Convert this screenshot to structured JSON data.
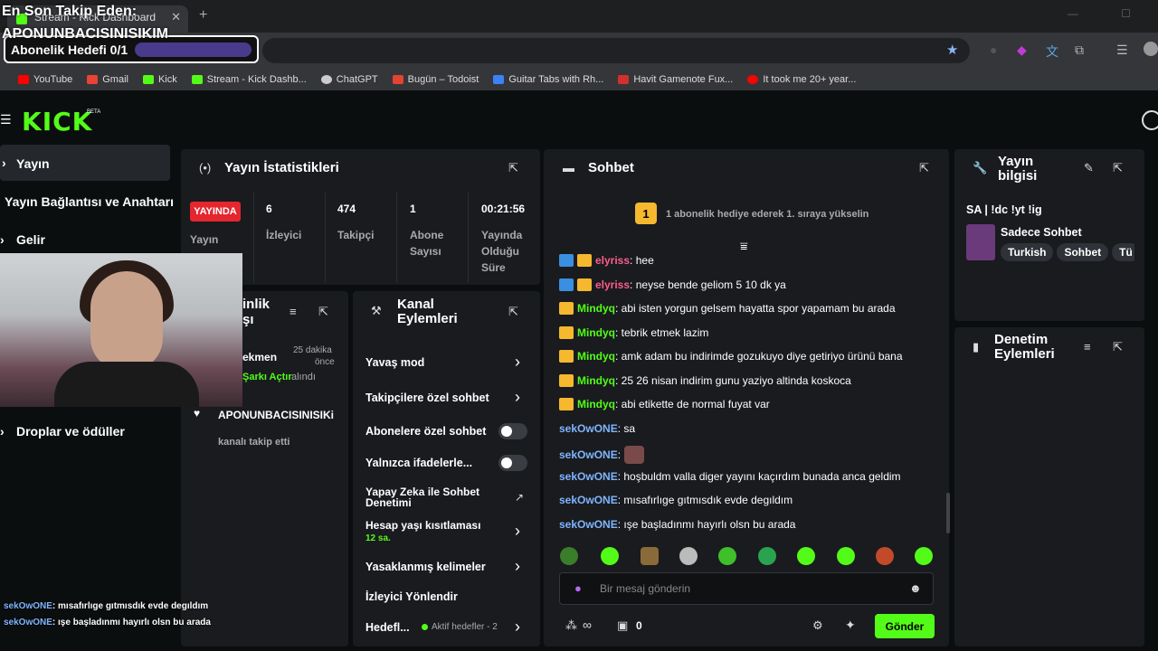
{
  "browser": {
    "tab_title": "Stream - Kick Dashboard",
    "new_tab": "+",
    "bookmarks": [
      {
        "label": "YouTube",
        "color": "#ff0000"
      },
      {
        "label": "Gmail",
        "color": "#ea4335"
      },
      {
        "label": "Kick",
        "color": "#53fc18"
      },
      {
        "label": "Stream - Kick Dashb...",
        "color": "#53fc18"
      },
      {
        "label": "ChatGPT",
        "color": "#cccccc"
      },
      {
        "label": "Bugün – Todoist",
        "color": "#e44332"
      },
      {
        "label": "Guitar Tabs with Rh...",
        "color": "#3b82f6"
      },
      {
        "label": "Havit Gamenote Fux...",
        "color": "#d32f2f"
      },
      {
        "label": "It took me 20+ year...",
        "color": "#ff0000"
      }
    ]
  },
  "overlay": {
    "last_follower_title": "En Son Takip Eden:",
    "last_follower_name": "APONUNBACISINISIKIM",
    "sub_goal": "Abonelik Hedefi 0/1",
    "chat": [
      {
        "user": "sekOwONE",
        "text": ": mısafırlıge gıtmısdık evde degıldım"
      },
      {
        "user": "sekOwONE",
        "text": ": ışe başladınmı hayırlı olsn bu arada"
      }
    ]
  },
  "kick": {
    "logo": "KICK",
    "beta": "BETA"
  },
  "sidebar": {
    "items": [
      {
        "label": "Yayın"
      },
      {
        "label": "Yayın Bağlantısı ve Anahtarı"
      },
      {
        "label": "Gelir"
      },
      {
        "label": "Droplar ve ödüller"
      }
    ]
  },
  "stats": {
    "title": "Yayın İstatistikleri",
    "live": "YAYINDA",
    "live_label": "Yayın",
    "viewers": "6",
    "viewers_label": "İzleyici",
    "followers": "474",
    "followers_label": "Takipçi",
    "subs": "1",
    "subs_label_1": "Abone",
    "subs_label_2": "Sayısı",
    "duration": "00:21:56",
    "duration_label_1": "Yayında",
    "duration_label_2": "Olduğu",
    "duration_label_3": "Süre"
  },
  "events": {
    "title_1": "inlik",
    "title_2": "şı",
    "item1_name": "ekmen",
    "item1_time_1": "25 dakika",
    "item1_time_2": "önce",
    "item1_action": "Şarkı Açtır",
    "item1_suffix": " alındı",
    "item2_name": "APONUNBACISINISIKi",
    "item2_desc": "kanalı takip etti"
  },
  "actions": {
    "title_1": "Kanal",
    "title_2": "Eylemleri",
    "items": [
      {
        "label": "Yavaş mod"
      },
      {
        "label": "Takipçilere özel sohbet"
      },
      {
        "label": "Abonelere özel sohbet"
      },
      {
        "label": "Yalnızca ifadelerle..."
      },
      {
        "label": "Yapay Zeka ile Sohbet"
      },
      {
        "label": "Denetimi"
      },
      {
        "label": "Hesap yaşı kısıtlaması"
      },
      {
        "label": "12 sa."
      },
      {
        "label": "Yasaklanmış kelimeler"
      },
      {
        "label": "İzleyici Yönlendir"
      },
      {
        "label": "Hedefl..."
      },
      {
        "label": "Aktif hedefler - 2"
      }
    ]
  },
  "chat": {
    "title": "Sohbet",
    "gift_rank": "1",
    "gift_text": "1 abonelik hediye ederek 1. sıraya yükselin",
    "messages": [
      {
        "user": "elyriss",
        "text": ": hee",
        "color": "#ff5c8a"
      },
      {
        "user": "elyriss",
        "text": ": neyse bende geliom 5 10 dk ya",
        "color": "#ff5c8a"
      },
      {
        "user": "Mindyq",
        "text": ": abi isten yorgun gelsem hayatta spor yapamam bu arada",
        "color": "#53fc18"
      },
      {
        "user": "Mindyq",
        "text": ": tebrik etmek lazim",
        "color": "#53fc18"
      },
      {
        "user": "Mindyq",
        "text": ": amk adam bu indirimde gozukuyo diye getiriyo ürünü bana",
        "color": "#53fc18"
      },
      {
        "user": "Mindyq",
        "text": ": 25 26 nisan indirim gunu yaziyo altinda koskoca",
        "color": "#53fc18"
      },
      {
        "user": "Mindyq",
        "text": ": abi etikette de normal fuyat var",
        "color": "#53fc18"
      },
      {
        "user": "sekOwONE",
        "text": ": sa",
        "color": "#7fb5ff"
      },
      {
        "user": "sekOwONE",
        "text": ":",
        "color": "#7fb5ff"
      },
      {
        "user": "sekOwONE",
        "text": ": hoşbuldm valla diger yayını kaçırdım bunada anca geldim",
        "color": "#7fb5ff"
      },
      {
        "user": "sekOwONE",
        "text": ": mısafırlıge gıtmısdık evde degıldım",
        "color": "#7fb5ff"
      },
      {
        "user": "sekOwONE",
        "text": ": ışe başladınmı hayırlı olsn bu arada",
        "color": "#7fb5ff"
      }
    ],
    "placeholder": "Bir mesaj gönderin",
    "points_symbol": "∞",
    "points_count": "0",
    "send": "Gönder"
  },
  "info": {
    "title_1": "Yayın",
    "title_2": "bilgisi",
    "stream_title": "SA | !dc !yt !ig",
    "category": "Sadece Sohbet",
    "tags": [
      "Turkish",
      "Sohbet",
      "Tü"
    ]
  },
  "mod": {
    "title_1": "Denetim",
    "title_2": "Eylemleri"
  }
}
